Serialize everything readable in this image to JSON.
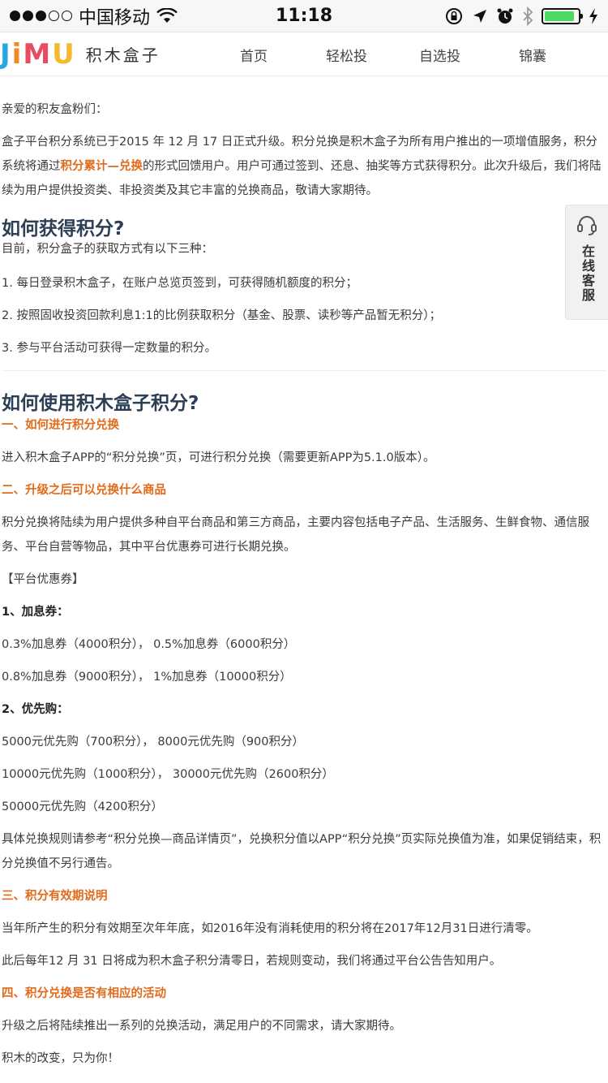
{
  "status_bar": {
    "carrier": "中国移动",
    "time": "11:18"
  },
  "header": {
    "logo_letters": [
      "J",
      "i",
      "M",
      "U"
    ],
    "logo_text": "积木盒子",
    "nav": [
      "首页",
      "轻松投",
      "自选投",
      "锦囊"
    ]
  },
  "side_service": {
    "label": "在线客服"
  },
  "article": {
    "greeting": "亲爱的积友盒粉们：",
    "intro_p1": "盒子平台积分系统已于2015 年 12 月 17 日正式升级。积分兑换是积木盒子为所有用户推出的一项增值服务，积分系统将通过",
    "intro_highlight": "积分累计—兑换",
    "intro_p2": "的形式回馈用户。用户可通过签到、还息、抽奖等方式获得积分。此次升级后，我们将陆续为用户提供投资类、非投资类及其它丰富的兑换商品，敬请大家期待。",
    "section1_title": "如何获得积分?",
    "section1_intro": "目前，积分盒子的获取方式有以下三种：",
    "section1_items": [
      "1. 每日登录积木盒子，在账户总览页签到，可获得随机额度的积分；",
      "2. 按照固收投资回款利息1:1的比例获取积分（基金、股票、读秒等产品暂无积分）；",
      "3. 参与平台活动可获得一定数量的积分。"
    ],
    "section2_title": "如何使用积木盒子积分?",
    "sub1_title": "一、如何进行积分兑换",
    "sub1_text": "进入积木盒子APP的“积分兑换”页，可进行积分兑换（需要更新APP为5.1.0版本）。",
    "sub2_title": "二、升级之后可以兑换什么商品",
    "sub2_text": "积分兑换将陆续为用户提供多种自平台商品和第三方商品，主要内容包括电子产品、生活服务、生鲜食物、通信服务、平台自营等物品，其中平台优惠券可进行长期兑换。",
    "coupon_header": "【平台优惠券】",
    "coupon_cat1": "1、加息券：",
    "coupon_cat1_lines": [
      "0.3%加息券（4000积分），  0.5%加息券（6000积分）",
      "0.8%加息券（9000积分），  1%加息券（10000积分）"
    ],
    "coupon_cat2": "2、优先购：",
    "coupon_cat2_lines": [
      "5000元优先购（700积分），  8000元优先购（900积分）",
      "10000元优先购（1000积分），  30000元优先购（2600积分）",
      "50000元优先购（4200积分）"
    ],
    "exchange_rule": "具体兑换规则请参考“积分兑换—商品详情页”，兑换积分值以APP“积分兑换”页实际兑换值为准，如果促销结束，积分兑换值不另行通告。",
    "sub3_title": "三、积分有效期说明",
    "sub3_text1": "当年所产生的积分有效期至次年年底，如2016年没有消耗使用的积分将在2017年12月31日进行清零。",
    "sub3_text2": "此后每年12 月 31 日将成为积木盒子积分清零日，若规则变动，我们将通过平台公告告知用户。",
    "sub4_title": "四、积分兑换是否有相应的活动",
    "sub4_text": "升级之后将陆续推出一系列的兑换活动，满足用户的不同需求，请大家期待。",
    "closing": "积木的改变，只为你！"
  },
  "colors": {
    "accent_orange": "#e26a1b",
    "heading_navy": "#2c3f55",
    "battery_green": "#4cd964"
  }
}
